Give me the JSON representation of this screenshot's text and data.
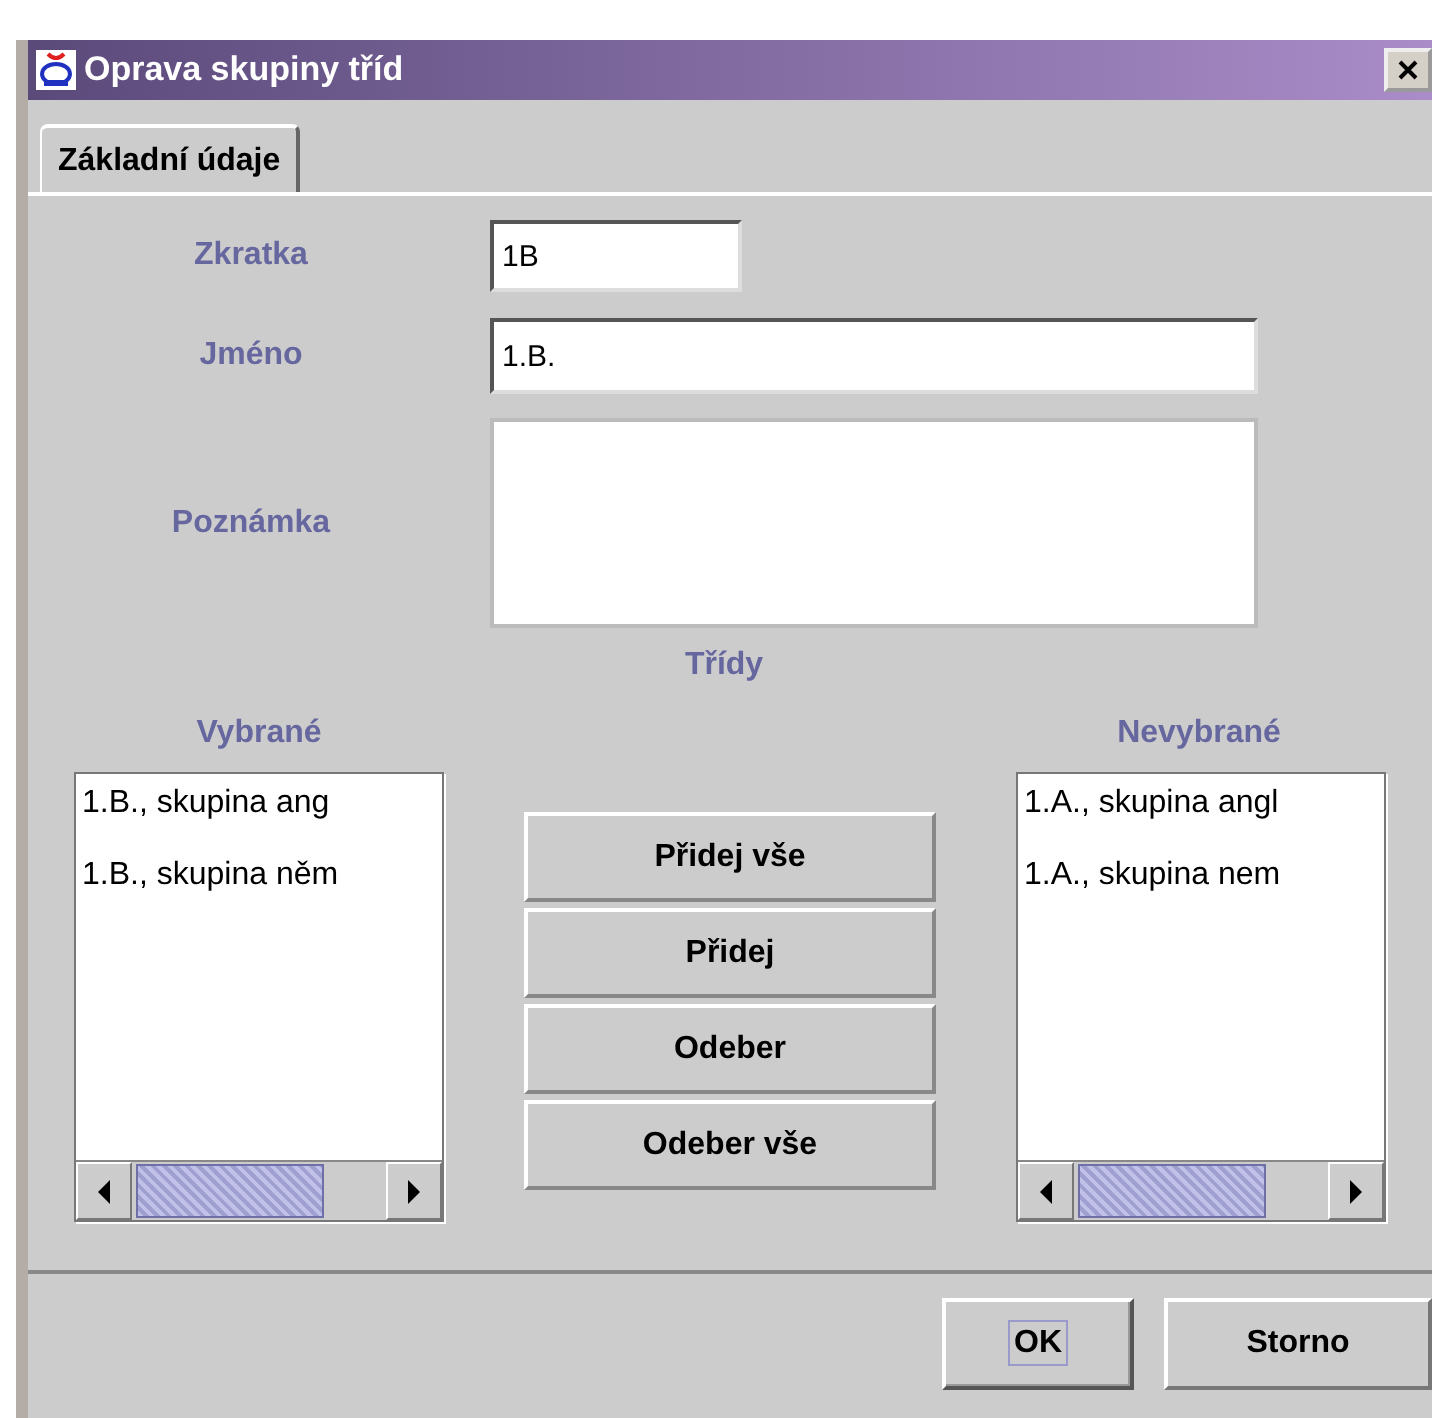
{
  "window": {
    "title": "Oprava skupiny tříd"
  },
  "tabs": [
    {
      "label": "Základní údaje",
      "selected": true
    }
  ],
  "fields": [
    {
      "label": "Zkratka",
      "value": "1B",
      "kind": "short"
    },
    {
      "label": "Jméno",
      "value": "1.B.",
      "kind": "line"
    },
    {
      "label": "Poznámka",
      "kind": "area"
    }
  ],
  "classes": {
    "title": "Třídy",
    "selected_list": {
      "label": "Vybrané",
      "items": [
        "1.B., skupina ang",
        "1.B., skupina něm"
      ]
    },
    "transfer_buttons": [
      "Přidej vše",
      "Přidej",
      "Odeber",
      "Odeber vše"
    ],
    "available_list": {
      "label": "Nevybrané",
      "items": [
        "1.A., skupina angl",
        "1.A., skupina nem"
      ]
    }
  },
  "buttons": [
    {
      "label": "OK",
      "focused": true
    },
    {
      "label": "Storno",
      "focused": false
    }
  ]
}
